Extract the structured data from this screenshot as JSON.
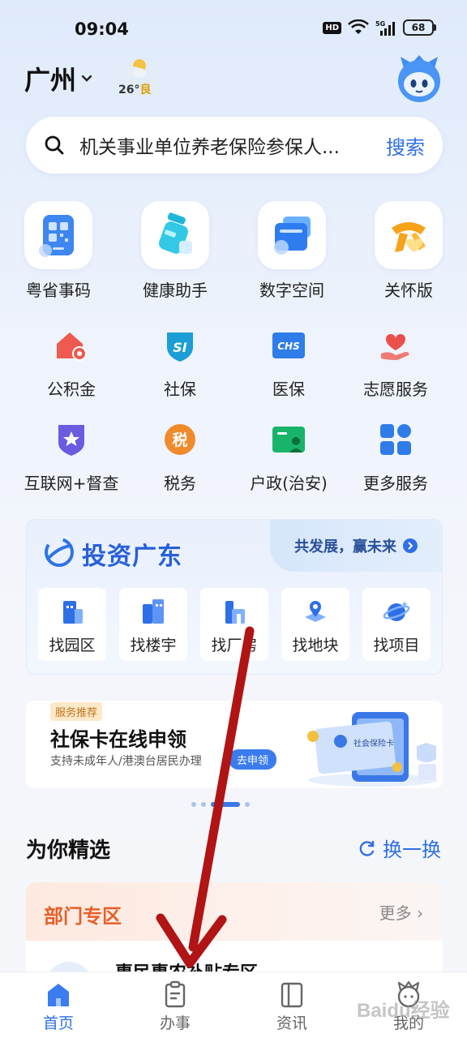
{
  "status_bar": {
    "time": "09:04",
    "hd": "HD",
    "network": "5G",
    "battery": "68"
  },
  "header": {
    "city": "广州",
    "weather": {
      "temp": "26°",
      "air_quality": "良",
      "icon": "partly-cloudy-icon"
    }
  },
  "search": {
    "placeholder": "机关事业单位养老保险参保人...",
    "button": "搜索"
  },
  "apps_primary": [
    {
      "label": "粤省事码",
      "icon": "qr-code-icon"
    },
    {
      "label": "健康助手",
      "icon": "health-bottle-icon"
    },
    {
      "label": "数字空间",
      "icon": "cards-icon"
    },
    {
      "label": "关怀版",
      "icon": "scarf-heart-icon"
    }
  ],
  "apps_secondary": [
    {
      "label": "公积金",
      "icon": "house-coin-icon"
    },
    {
      "label": "社保",
      "icon": "si-shield-icon"
    },
    {
      "label": "医保",
      "icon": "chs-card-icon"
    },
    {
      "label": "志愿服务",
      "icon": "hand-heart-icon"
    },
    {
      "label": "互联网+督查",
      "icon": "star-shield-icon"
    },
    {
      "label": "税务",
      "icon": "tax-coin-icon"
    },
    {
      "label": "户政(治安)",
      "icon": "id-card-icon"
    },
    {
      "label": "更多服务",
      "icon": "grid-icon"
    }
  ],
  "invest": {
    "title": "投资广东",
    "slogan": "共发展，赢未来",
    "finders": [
      {
        "label": "找园区",
        "icon": "park-building-icon"
      },
      {
        "label": "找楼宇",
        "icon": "tower-building-icon"
      },
      {
        "label": "找厂房",
        "icon": "factory-icon"
      },
      {
        "label": "找地块",
        "icon": "land-pin-icon"
      },
      {
        "label": "找项目",
        "icon": "project-planet-icon"
      }
    ]
  },
  "banner": {
    "tag": "服务推荐",
    "title": "社保卡在线申领",
    "subtitle": "支持未成年人/港澳台居民办理",
    "apply_button": "去申领",
    "card_text": "社会保险卡"
  },
  "picks": {
    "title": "为你精选",
    "refresh": "换一换",
    "section_title": "部门专区",
    "more": "更多",
    "first_item": "惠民惠农补贴专区"
  },
  "bottom_nav": [
    {
      "label": "首页",
      "icon": "home-icon",
      "active": true
    },
    {
      "label": "办事",
      "icon": "clipboard-icon",
      "active": false
    },
    {
      "label": "资讯",
      "icon": "book-icon",
      "active": false
    },
    {
      "label": "我的",
      "icon": "profile-icon",
      "active": false
    }
  ],
  "watermark": "Baidu经验",
  "colors": {
    "accent": "#2f6fe6",
    "dept_accent": "#e6602a",
    "arrow": "#b01414"
  }
}
